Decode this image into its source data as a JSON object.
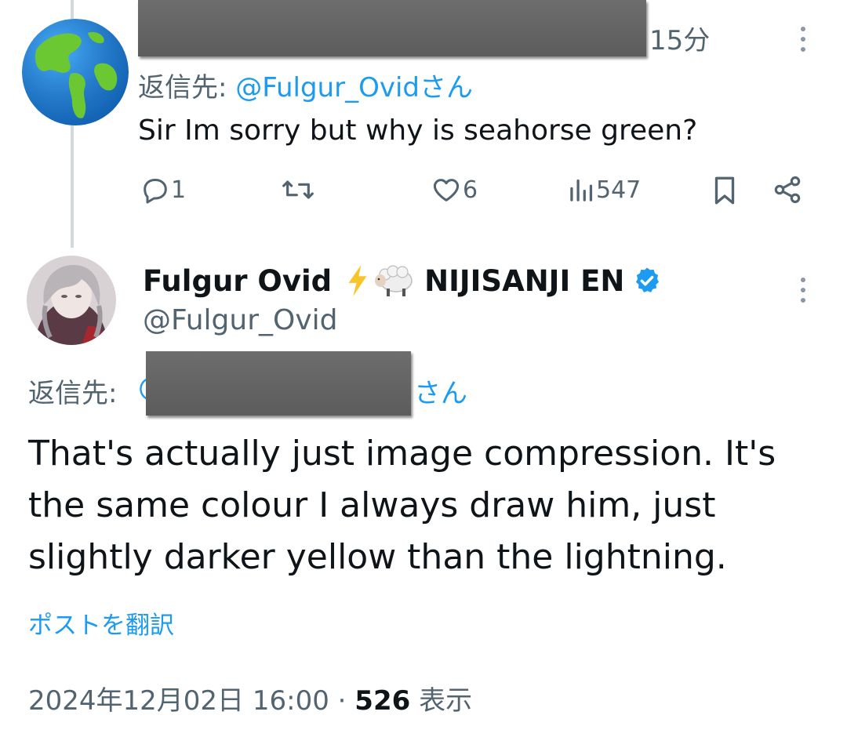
{
  "reply_tweet": {
    "time": "15分",
    "reply_prefix": "返信先: ",
    "reply_to_handle": "@Fulgur_Ovid",
    "reply_suffix": "さん",
    "text": "Sir Im sorry but why is seahorse green?",
    "actions": {
      "reply_count": "1",
      "retweet_count": "",
      "like_count": "6",
      "view_count": "547"
    }
  },
  "main_tweet": {
    "author_name": "Fulgur Ovid",
    "author_emojis": "⚡🐑",
    "author_suffix": "NIJISANJI EN",
    "author_handle": "@Fulgur_Ovid",
    "reply_prefix": "返信先: ",
    "reply_at": "@",
    "reply_suffix": "さん",
    "text": "That's actually just image compression. It's the same colour I always draw him, just slightly darker yellow than the lightning.",
    "translate_label": "ポストを翻訳",
    "timestamp": "2024年12月02日 16:00",
    "separator": " · ",
    "view_count": "526",
    "view_label": " 表示"
  },
  "colors": {
    "accent": "#1d9bf0",
    "muted": "#536471",
    "text": "#0f1419",
    "verified": "#1d9bf0"
  },
  "icons": [
    "globe-avatar",
    "more-icon",
    "reply-icon",
    "retweet-icon",
    "like-icon",
    "views-icon",
    "bookmark-icon",
    "share-icon",
    "verified-badge-icon",
    "lightning-emoji",
    "sheep-emoji"
  ]
}
